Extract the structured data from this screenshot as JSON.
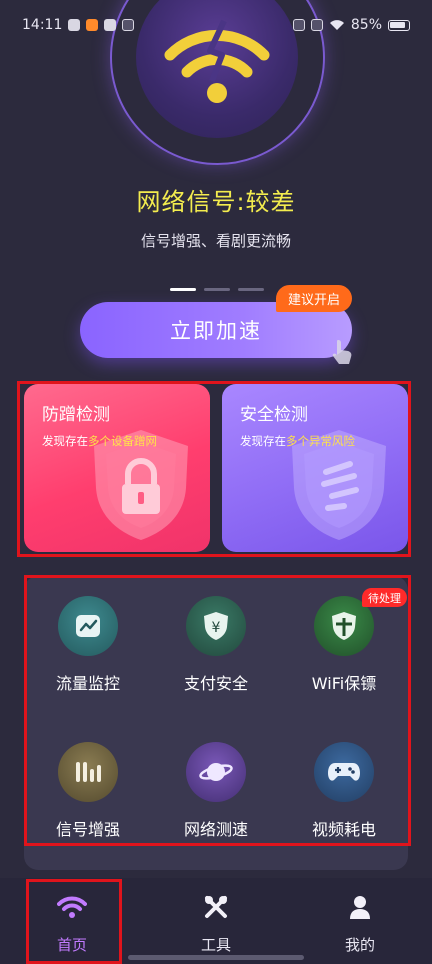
{
  "status_bar": {
    "time": "14:11",
    "battery": "85%"
  },
  "hero": {
    "title": "网络信号:较差",
    "subtitle": "信号增强、看剧更流畅",
    "page_count": 3,
    "active_page": 1
  },
  "boost": {
    "button_label": "立即加速",
    "badge": "建议开启"
  },
  "cards": [
    {
      "title": "防蹭检测",
      "desc_prefix": "发现存在",
      "desc_highlight": "多个设备蹭网",
      "icon": "lock-shield-icon"
    },
    {
      "title": "安全检测",
      "desc_prefix": "发现存在",
      "desc_highlight": "多个异常风险",
      "icon": "security-shield-icon"
    }
  ],
  "tools": {
    "pending_badge": "待处理",
    "items": [
      {
        "label": "流量监控",
        "icon": "chart-line-icon",
        "color": "#2e6f74"
      },
      {
        "label": "支付安全",
        "icon": "shield-yuan-icon",
        "color": "#2d5a4e"
      },
      {
        "label": "WiFi保镖",
        "icon": "shield-cross-icon",
        "color": "#2f6a3a"
      },
      {
        "label": "信号增强",
        "icon": "signal-bars-icon",
        "color": "#6b6040"
      },
      {
        "label": "网络测速",
        "icon": "planet-icon",
        "color": "#5a3f8f"
      },
      {
        "label": "视频耗电",
        "icon": "gamepad-icon",
        "color": "#2e4f7a"
      }
    ]
  },
  "nav": {
    "items": [
      {
        "label": "首页",
        "icon": "wifi-icon"
      },
      {
        "label": "工具",
        "icon": "tools-icon"
      },
      {
        "label": "我的",
        "icon": "user-icon"
      }
    ]
  },
  "colors": {
    "background": "#2c2a3d",
    "accent_yellow": "#f3ec4e",
    "accent_purple": "#8a64ff",
    "badge_orange": "#ff6a1a",
    "highlight_red": "#e0141c",
    "nav_active": "#c27bff"
  }
}
